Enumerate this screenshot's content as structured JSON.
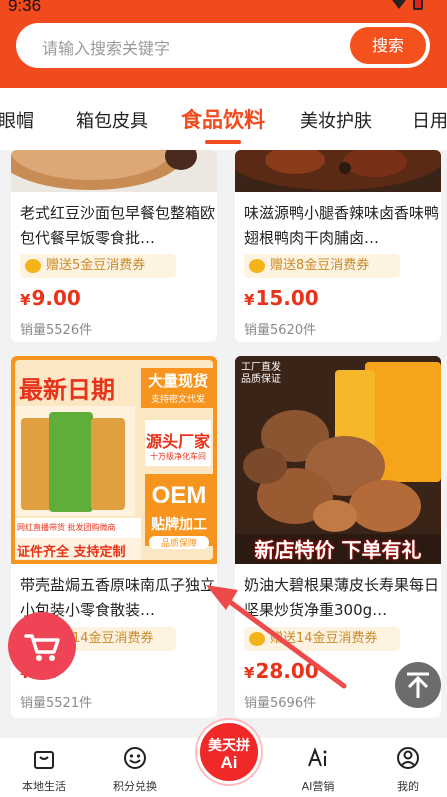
{
  "status_bar": {
    "time": "9:36"
  },
  "search": {
    "placeholder": "请输入搜索关键字",
    "button_label": "搜索"
  },
  "tabs": [
    {
      "label": "眼帽"
    },
    {
      "label": "箱包皮具"
    },
    {
      "label": "食品饮料",
      "active": true
    },
    {
      "label": "美妆护肤"
    },
    {
      "label": "日用"
    }
  ],
  "products": [
    {
      "title": "老式红豆沙面包早餐包整箱欧包代餐早饭零食批…",
      "coupon": "赠送5金豆消费券",
      "price": "9.00",
      "currency": "¥",
      "sales": "销量5526件"
    },
    {
      "title": "味滋源鸭小腿香辣味卤香味鸭翅根鸭肉干肉脯卤…",
      "coupon": "赠送8金豆消费券",
      "price": "15.00",
      "currency": "¥",
      "sales": "销量5620件"
    },
    {
      "title": "带壳盐焗五香原味南瓜子独立小包装小零食散装…",
      "coupon": "赠送14金豆消费券",
      "coupon_visible": "4金豆消费券",
      "price": "00",
      "currency": "¥",
      "sales": "销量5521件",
      "image_text": {
        "line1": "最新日期",
        "badge1": "大量现货",
        "badge1_sub": "支持密文代发",
        "badge2": "源头厂家",
        "badge2_sub": "十万级净化车间",
        "badge3": "OEM",
        "badge3_sub": "贴牌加工",
        "badge3_tag": "品质保障",
        "footer1": "网红直播带货 批发团购微商",
        "footer2": "证件齐全 支持定制"
      }
    },
    {
      "title": "奶油大碧根果薄皮长寿果每日坚果炒货净重300g…",
      "coupon": "赠送14金豆消费券",
      "price": "28.00",
      "currency": "¥",
      "sales": "销量5696件",
      "image_text": {
        "corner1": "工厂直发",
        "corner2": "品质保证",
        "banner": "新店特价 下单有礼"
      }
    }
  ],
  "bottom_nav": [
    {
      "label": "本地生活",
      "icon": "shopping-bag-icon"
    },
    {
      "label": "积分兑换",
      "icon": "smile-face-icon"
    },
    {
      "label": "美天拼",
      "sub": "Ai",
      "icon": "center-logo"
    },
    {
      "label": "AI营销",
      "icon": "ai-icon"
    },
    {
      "label": "我的",
      "icon": "user-icon"
    }
  ],
  "colors": {
    "brand": "#f04a1d",
    "price": "#e8321a",
    "coupon_text": "#c98a2a",
    "cart_float": "#ee4455"
  }
}
